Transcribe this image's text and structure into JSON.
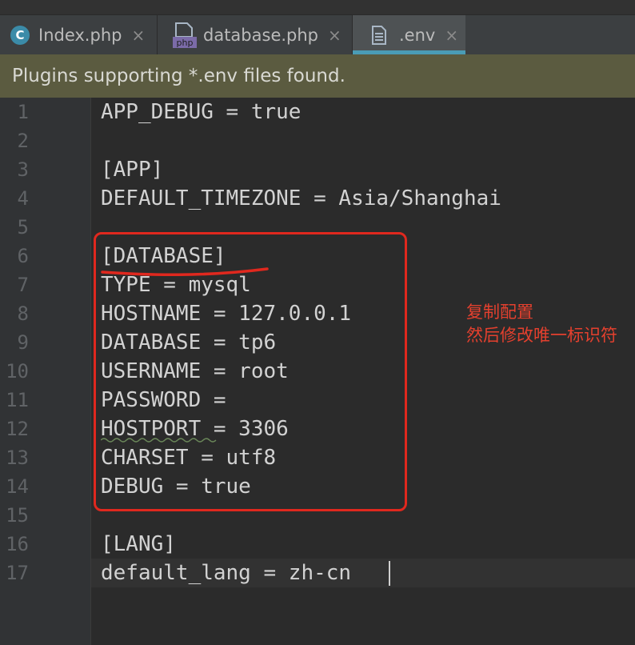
{
  "tabs": [
    {
      "label": "Index.php",
      "icon": "c-class-icon",
      "close": "×"
    },
    {
      "label": "database.php",
      "icon": "php-file-icon",
      "icon_text": "php",
      "close": "×"
    },
    {
      "label": ".env",
      "icon": "text-file-icon",
      "close": "×",
      "active": true
    }
  ],
  "banner": {
    "text": "Plugins supporting *.env files found."
  },
  "editor": {
    "line_numbers": [
      "1",
      "2",
      "3",
      "4",
      "5",
      "6",
      "7",
      "8",
      "9",
      "10",
      "11",
      "12",
      "13",
      "14",
      "15",
      "16",
      "17"
    ],
    "lines": [
      "APP_DEBUG = true",
      "",
      "[APP]",
      "DEFAULT_TIMEZONE = Asia/Shanghai",
      "",
      "[DATABASE]",
      "TYPE = mysql",
      "HOSTNAME = 127.0.0.1",
      "DATABASE = tp6",
      "USERNAME = root",
      "PASSWORD = ",
      "HOSTPORT = 3306",
      "CHARSET = utf8",
      "DEBUG = true",
      "",
      "[LANG]",
      "default_lang = zh-cn"
    ]
  },
  "annotation": {
    "line1": "复制配置",
    "line2": "然后修改唯一标识符",
    "color": "#e0281e"
  },
  "colors": {
    "accent": "#4a9cb5",
    "banner_bg": "#5b5b40",
    "editor_bg": "#2b2b2b"
  }
}
